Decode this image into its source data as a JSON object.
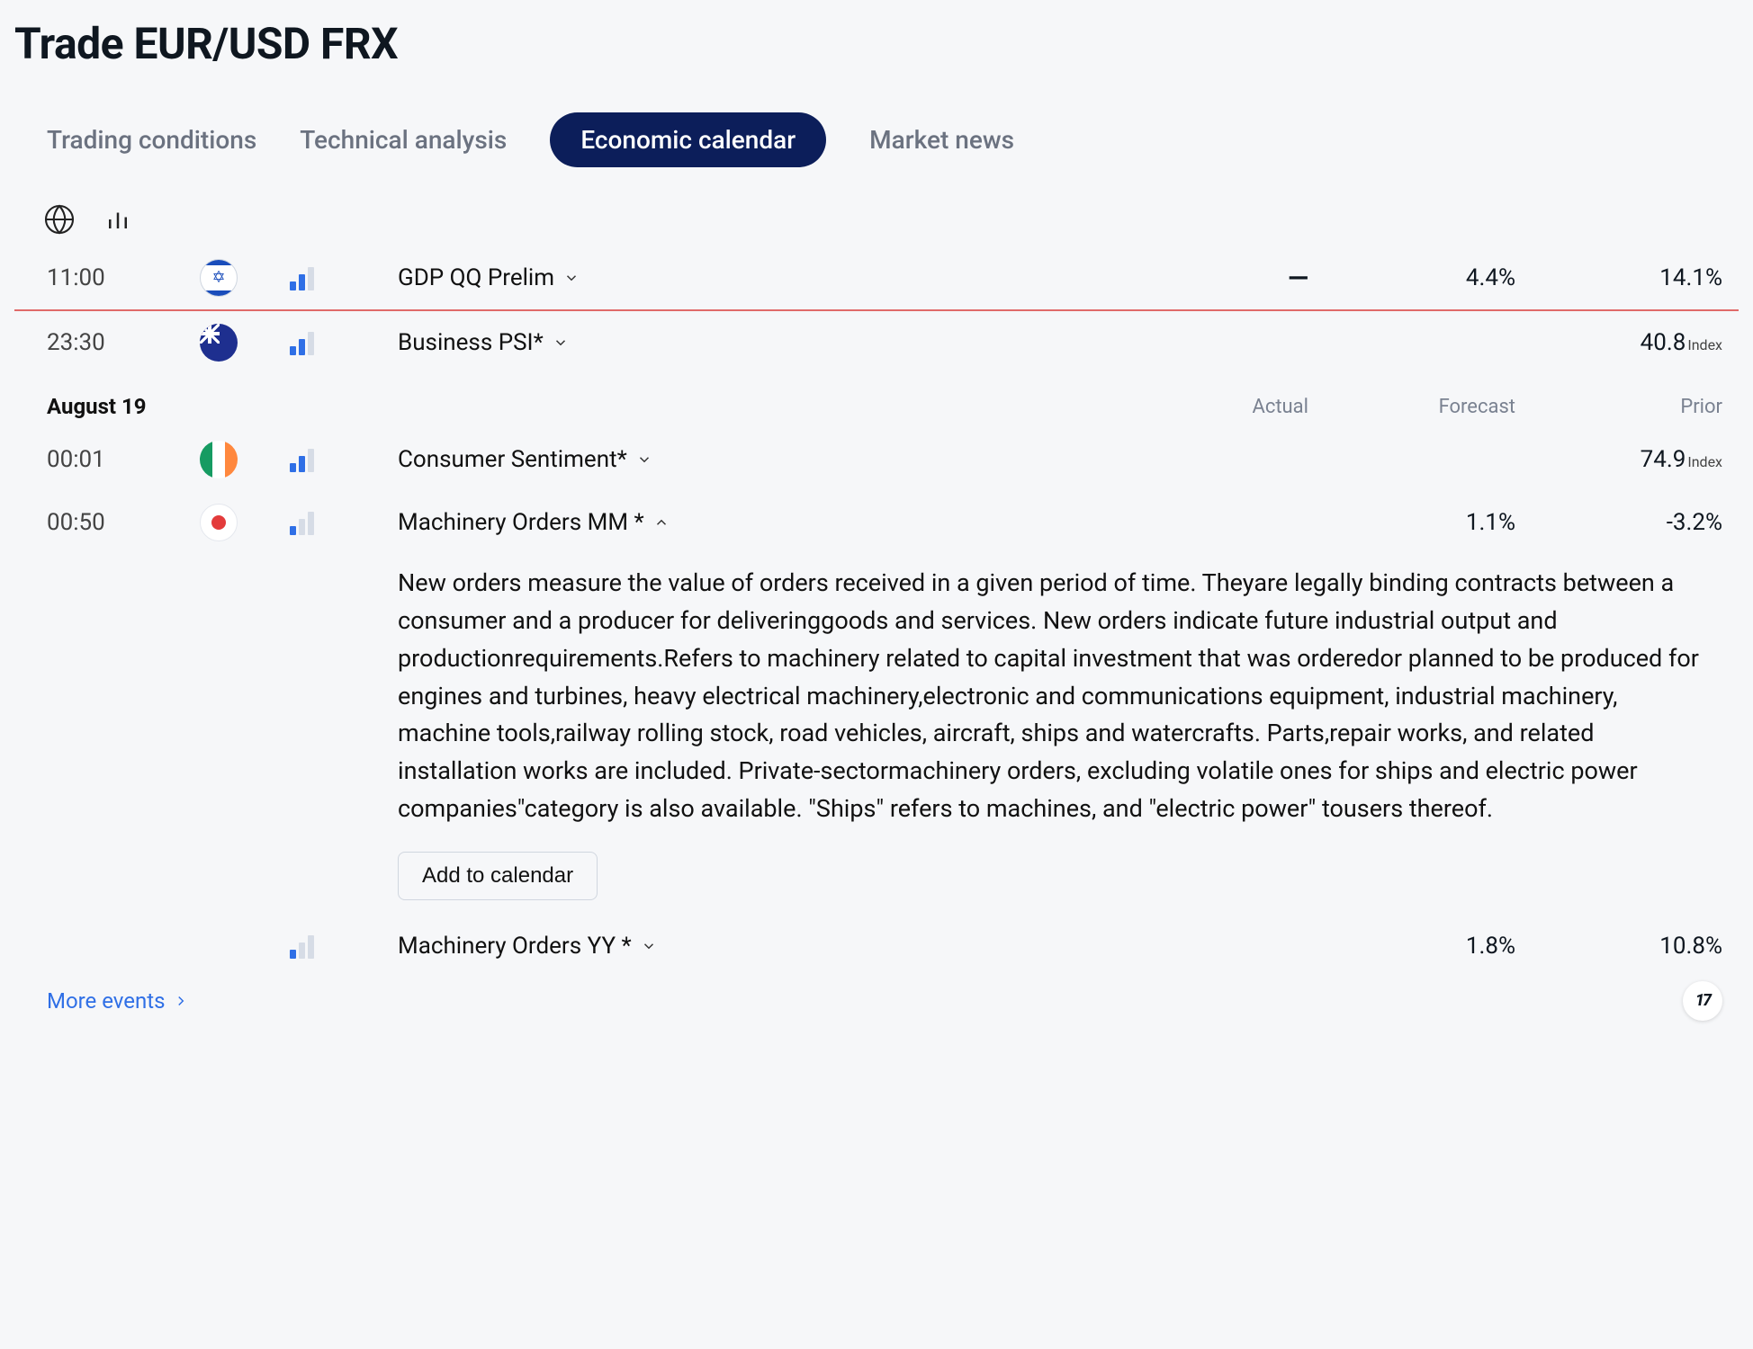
{
  "page_title": "Trade EUR/USD FRX",
  "tabs": {
    "trading_conditions": "Trading conditions",
    "technical_analysis": "Technical analysis",
    "economic_calendar": "Economic calendar",
    "market_news": "Market news",
    "active": "economic_calendar"
  },
  "toolbar": {
    "globe_name": "globe-icon",
    "bars_name": "bars-icon"
  },
  "header_labels": {
    "actual": "Actual",
    "forecast": "Forecast",
    "prior": "Prior"
  },
  "date_header": "August 19",
  "events": [
    {
      "time": "11:00",
      "country": "IL",
      "impact": 2,
      "name": "GDP QQ Prelim",
      "expanded": false,
      "actual": "—",
      "forecast": "4.4%",
      "prior": "14.1%"
    },
    {
      "time": "23:30",
      "country": "NZ",
      "impact": 2,
      "name": "Business PSI*",
      "expanded": false,
      "actual": "",
      "forecast": "",
      "prior": "40.8",
      "prior_unit": "Index"
    },
    {
      "time": "00:01",
      "country": "IE",
      "impact": 2,
      "name": "Consumer Sentiment*",
      "expanded": false,
      "actual": "",
      "forecast": "",
      "prior": "74.9",
      "prior_unit": "Index"
    },
    {
      "time": "00:50",
      "country": "JP",
      "impact": 1,
      "name": "Machinery Orders MM *",
      "expanded": true,
      "actual": "",
      "forecast": "1.1%",
      "prior": "-3.2%",
      "description": "New orders measure the value of orders received in a given period of time. Theyare legally binding contracts between a consumer and a producer for deliveringgoods and services. New orders indicate future industrial output and productionrequirements.Refers to machinery related to capital investment that was orderedor planned to be produced for engines and turbines, heavy electrical machinery,electronic and communications equipment, industrial machinery, machine tools,railway rolling stock, road vehicles, aircraft, ships and watercrafts. Parts,repair works, and related installation works are included. Private-sectormachinery orders, excluding volatile ones for ships and electric power companies\"category is also available. \"Ships\" refers to machines, and \"electric power\" tousers thereof."
    },
    {
      "time": "",
      "country": "",
      "impact": 1,
      "name": "Machinery Orders YY *",
      "expanded": false,
      "actual": "",
      "forecast": "1.8%",
      "prior": "10.8%"
    }
  ],
  "buttons": {
    "add_to_calendar": "Add to calendar",
    "more_events": "More events"
  },
  "tv_badge": "17"
}
